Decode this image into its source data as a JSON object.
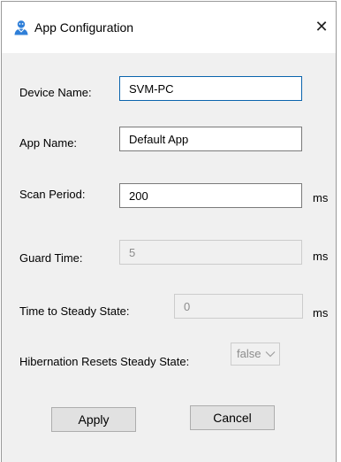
{
  "window": {
    "title": "App Configuration",
    "close_glyph": "✕",
    "icon": "user-icon"
  },
  "fields": {
    "device_name": {
      "label": "Device Name:",
      "value": "SVM-PC"
    },
    "app_name": {
      "label": "App Name:",
      "value": "Default App"
    },
    "scan_period": {
      "label": "Scan Period:",
      "value": "200",
      "unit": "ms"
    },
    "guard_time": {
      "label": "Guard Time:",
      "value": "5",
      "unit": "ms",
      "enabled": false
    },
    "time_to_steady_state": {
      "label": "Time to Steady State:",
      "value": "0",
      "unit": "ms",
      "enabled": false
    },
    "hibernation_resets": {
      "label": "Hibernation Resets Steady State:",
      "value": "false",
      "enabled": false
    }
  },
  "buttons": {
    "apply": "Apply",
    "cancel": "Cancel"
  },
  "colors": {
    "dialog_bg": "#f0f0f0",
    "focus_border": "#0a64ad",
    "disabled_text": "#8c8c8c",
    "icon_blue": "#2f7fd8"
  }
}
